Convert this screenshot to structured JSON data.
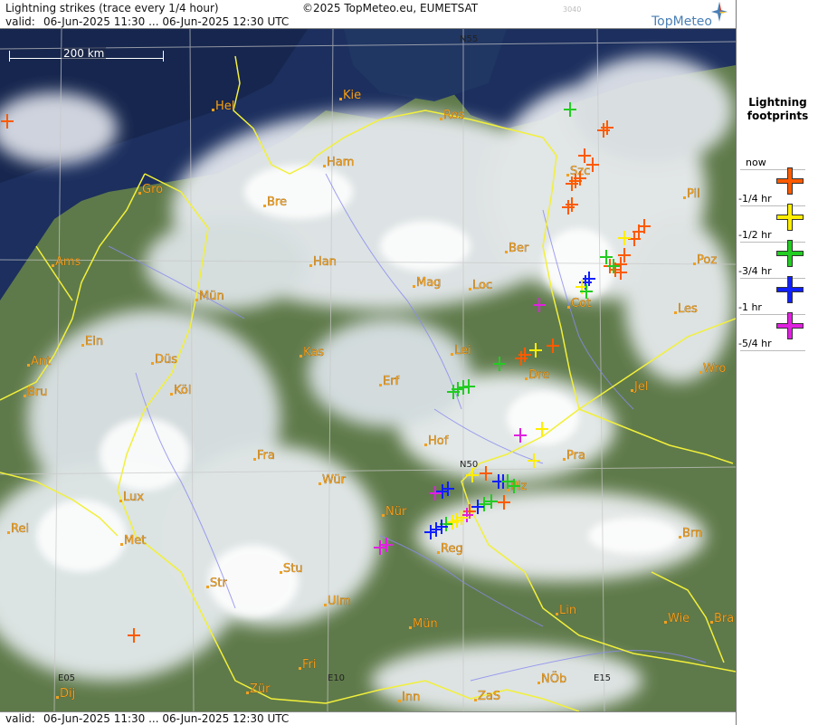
{
  "header": {
    "title": "Lightning strikes (trace every 1/4 hour)",
    "valid_label": "valid:",
    "valid_range": "06-Jun-2025 11:30 ... 06-Jun-2025 12:30 UTC",
    "copyright": "©2025 TopMeteo.eu, EUMETSAT",
    "code": "3040",
    "brand": "TopMeteo"
  },
  "footer": {
    "valid_label": "valid:",
    "valid_range": "06-Jun-2025 11:30 ... 06-Jun-2025 12:30 UTC"
  },
  "scale_bar": {
    "label": "200 km"
  },
  "coordinate_labels": [
    "N55",
    "N50",
    "E05",
    "E10",
    "E15"
  ],
  "cities": [
    "Hel",
    "Kie",
    "Ros",
    "Ham",
    "Szc",
    "Gro",
    "Bre",
    "Pil",
    "Ber",
    "Ams",
    "Han",
    "Poz",
    "Mag",
    "Loc",
    "Cot",
    "Mün",
    "Les",
    "Ein",
    "Kas",
    "Lei",
    "Ant",
    "Düs",
    "Dre",
    "Wro",
    "Bru",
    "Köl",
    "Erf",
    "Jel",
    "Hof",
    "Fra",
    "Pra",
    "Lux",
    "Wür",
    "Plz",
    "Rei",
    "Nür",
    "Met",
    "Reg",
    "Brn",
    "Stu",
    "Str",
    "Ulm",
    "Lin",
    "Wie",
    "Bra",
    "Mün",
    "Fri",
    "Zür",
    "Inn",
    "ZaS",
    "NÖb",
    "Dij"
  ],
  "legend": {
    "title_line1": "Lightning",
    "title_line2": "footprints",
    "entries": [
      {
        "label": "now",
        "color": "#ff5a00"
      },
      {
        "label": "-1/4 hr",
        "color": "#ffee00"
      },
      {
        "label": "-1/2 hr",
        "color": "#22cc22"
      },
      {
        "label": "-3/4 hr",
        "color": "#1020ff"
      },
      {
        "label": "-1 hr",
        "color": "#e020e0"
      },
      {
        "label": "-5/4 hr",
        "color": ""
      }
    ]
  },
  "colors": {
    "border": "#f2f03a",
    "river": "#8a8af0",
    "grid": "#c8c8c8",
    "city_label": "#f0a020"
  }
}
